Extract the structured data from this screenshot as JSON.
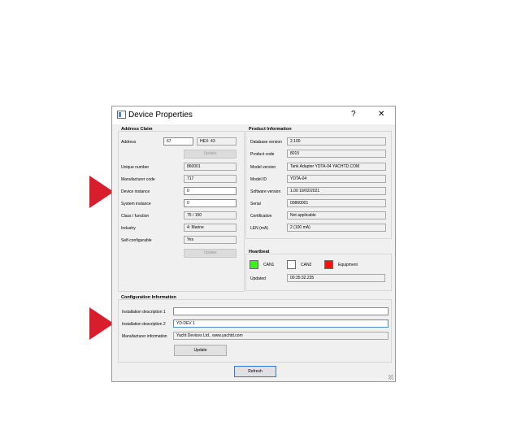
{
  "window": {
    "title": "Device Properties",
    "help": "?",
    "close": "✕"
  },
  "address_claim": {
    "title": "Address Claim",
    "address_label": "Address",
    "address_value": "67",
    "hex_value": "HEX: 43",
    "update_label": "Update",
    "unique_number_label": "Unique number",
    "unique_number_value": "860001",
    "manufacturer_code_label": "Manufacturer code",
    "manufacturer_code_value": "717",
    "device_instance_label": "Device instance",
    "device_instance_value": "0",
    "system_instance_label": "System instance",
    "system_instance_value": "0",
    "class_function_label": "Class / function",
    "class_function_value": "75 / 150",
    "industry_label": "Industry",
    "industry_value": "4: Marine",
    "self_configurable_label": "Self-configurable",
    "self_configurable_value": "Yes",
    "update2_label": "Update"
  },
  "product_information": {
    "title": "Product Information",
    "database_version_label": "Database version",
    "database_version_value": "2.100",
    "product_code_label": "Product code",
    "product_code_value": "8015",
    "model_version_label": "Model version",
    "model_version_value": "Tank Adapter YDTA-04 YACHTD.COM",
    "model_id_label": "Model ID",
    "model_id_value": "YDTA-04",
    "software_version_label": "Software version",
    "software_version_value": "1.00 19/02/2021",
    "serial_label": "Serial",
    "serial_value": "00860001",
    "certification_label": "Certification",
    "certification_value": "Not applicable",
    "len_label": "LEN (mA)",
    "len_value": "2 (100 mA)"
  },
  "heartbeat": {
    "title": "Heartbeat",
    "can1_label": "CAN1",
    "can2_label": "CAN2",
    "equipment_label": "Equipment",
    "updated_label": "Updated",
    "updated_value": "00:35:32.235",
    "colors": {
      "can1": "#3cf01e",
      "can2": "#ffffff",
      "equipment": "#ff1010"
    }
  },
  "configuration_information": {
    "title": "Configuration Information",
    "installation_desc1_label": "Installation description 1",
    "installation_desc1_value": "",
    "installation_desc2_label": "Installation description 2",
    "installation_desc2_value": "YD:DEV 1",
    "manufacturer_info_label": "Manufacturer information",
    "manufacturer_info_value": "Yacht Devices Ltd., www.yachtd.com",
    "update_label": "Update"
  },
  "footer": {
    "refresh_label": "Refresh"
  },
  "annotations": {
    "arrow_color": "#d81e2c"
  }
}
